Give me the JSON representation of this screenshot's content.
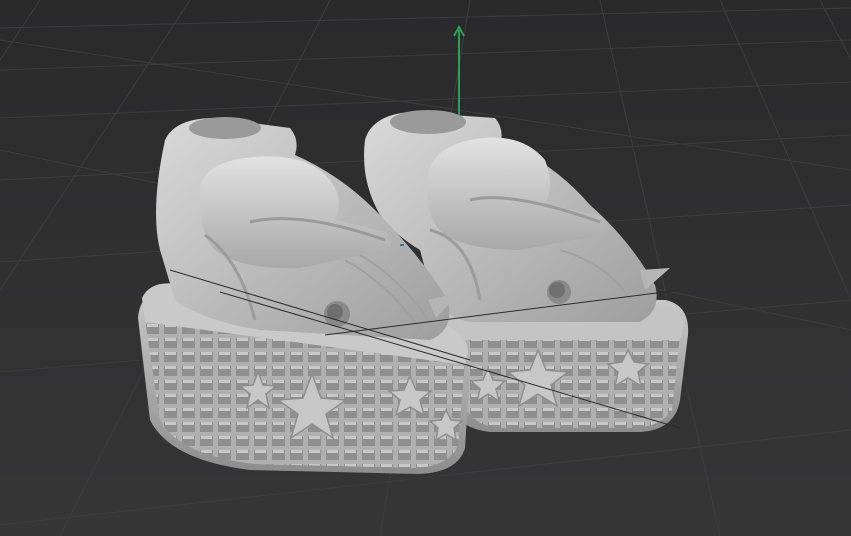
{
  "viewport": {
    "kind": "3d-viewport",
    "background_color": "#303031",
    "grid_color": "#3b3b3c",
    "model_color": "#bdbdbd",
    "gizmo_color": "#2e9e5a",
    "object": "pair-of-platform-sneakers"
  }
}
